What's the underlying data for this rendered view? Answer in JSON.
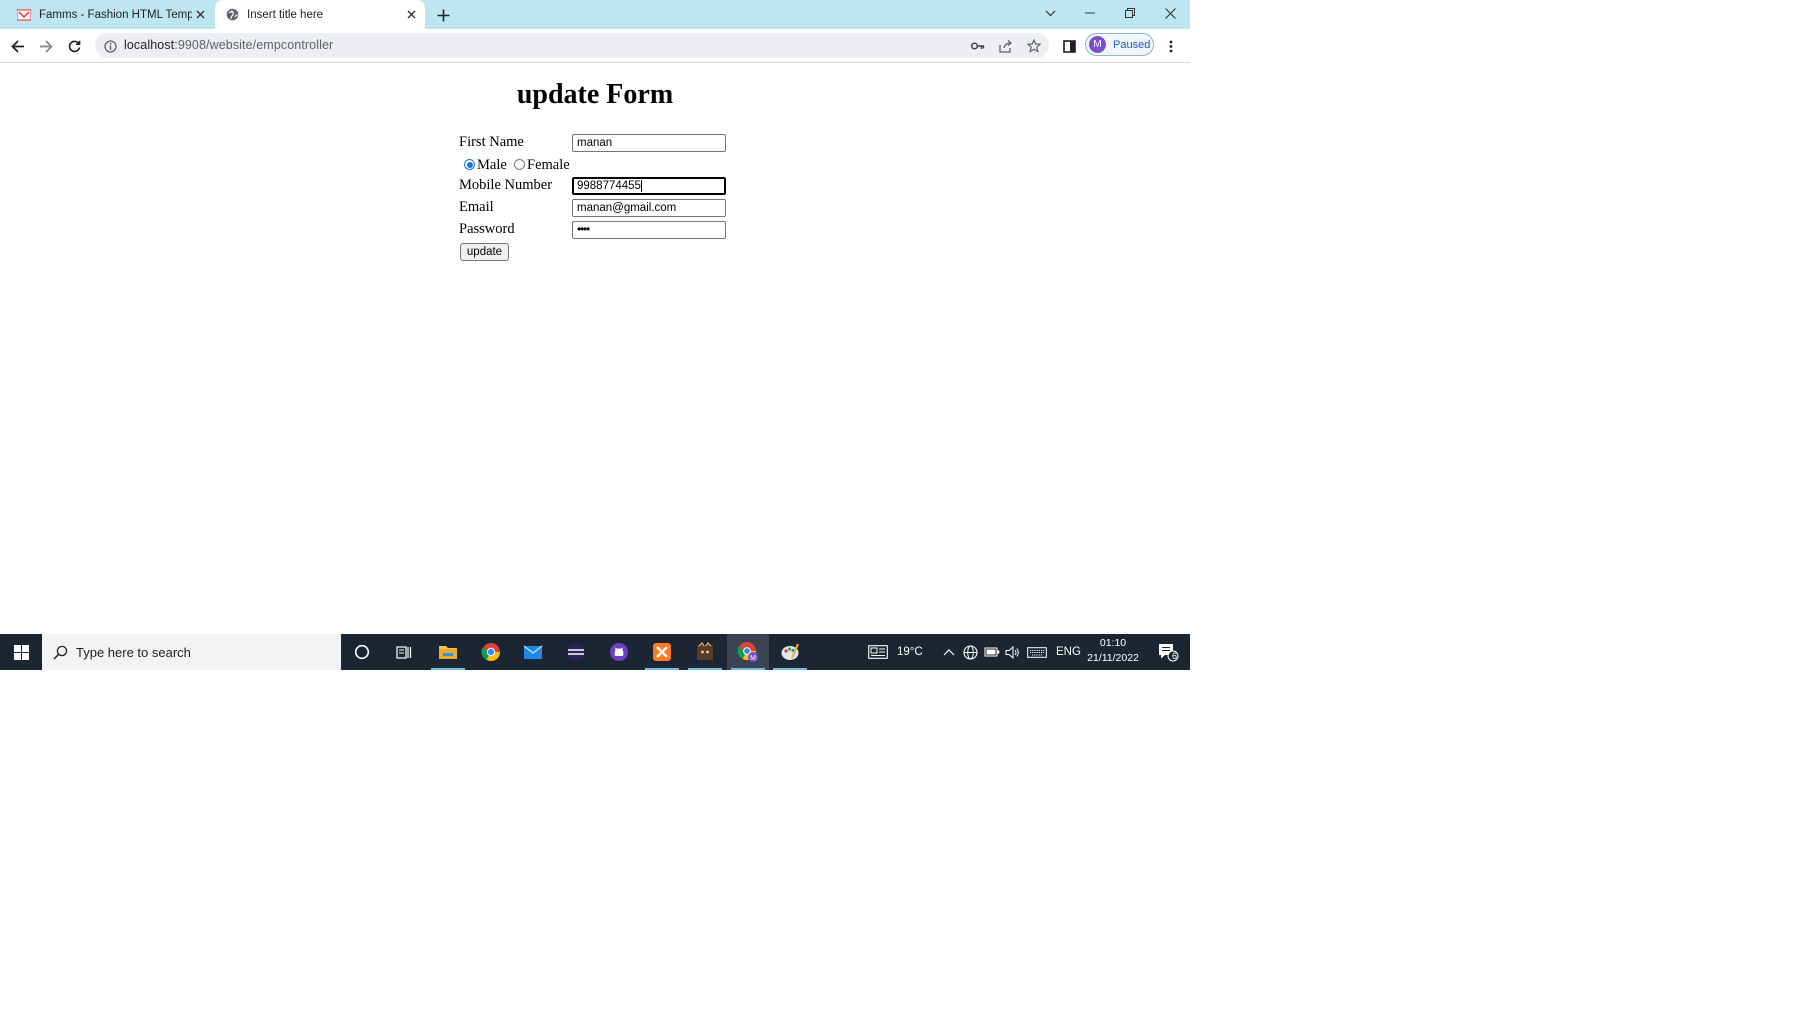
{
  "browser": {
    "tabs": [
      {
        "title": "Famms - Fashion HTML Template",
        "active": false
      },
      {
        "title": "Insert title here",
        "active": true
      }
    ],
    "url_host": "localhost",
    "url_path": ":9908/website/empcontroller",
    "profile_initial": "M",
    "profile_status": "Paused"
  },
  "form": {
    "title": "update Form",
    "first_name_label": "First Name",
    "first_name_value": "manan",
    "gender_options": [
      "Male",
      "Female"
    ],
    "gender_selected": "Male",
    "mobile_label": "Mobile Number",
    "mobile_value": "9988774455",
    "email_label": "Email",
    "email_value": "manan@gmail.com",
    "password_label": "Password",
    "password_masked": "••••",
    "submit_label": "update"
  },
  "taskbar": {
    "search_placeholder": "Type here to search",
    "weather": "19°C",
    "language": "ENG",
    "time": "01:10",
    "date": "21/11/2022",
    "notification_count": "6"
  }
}
